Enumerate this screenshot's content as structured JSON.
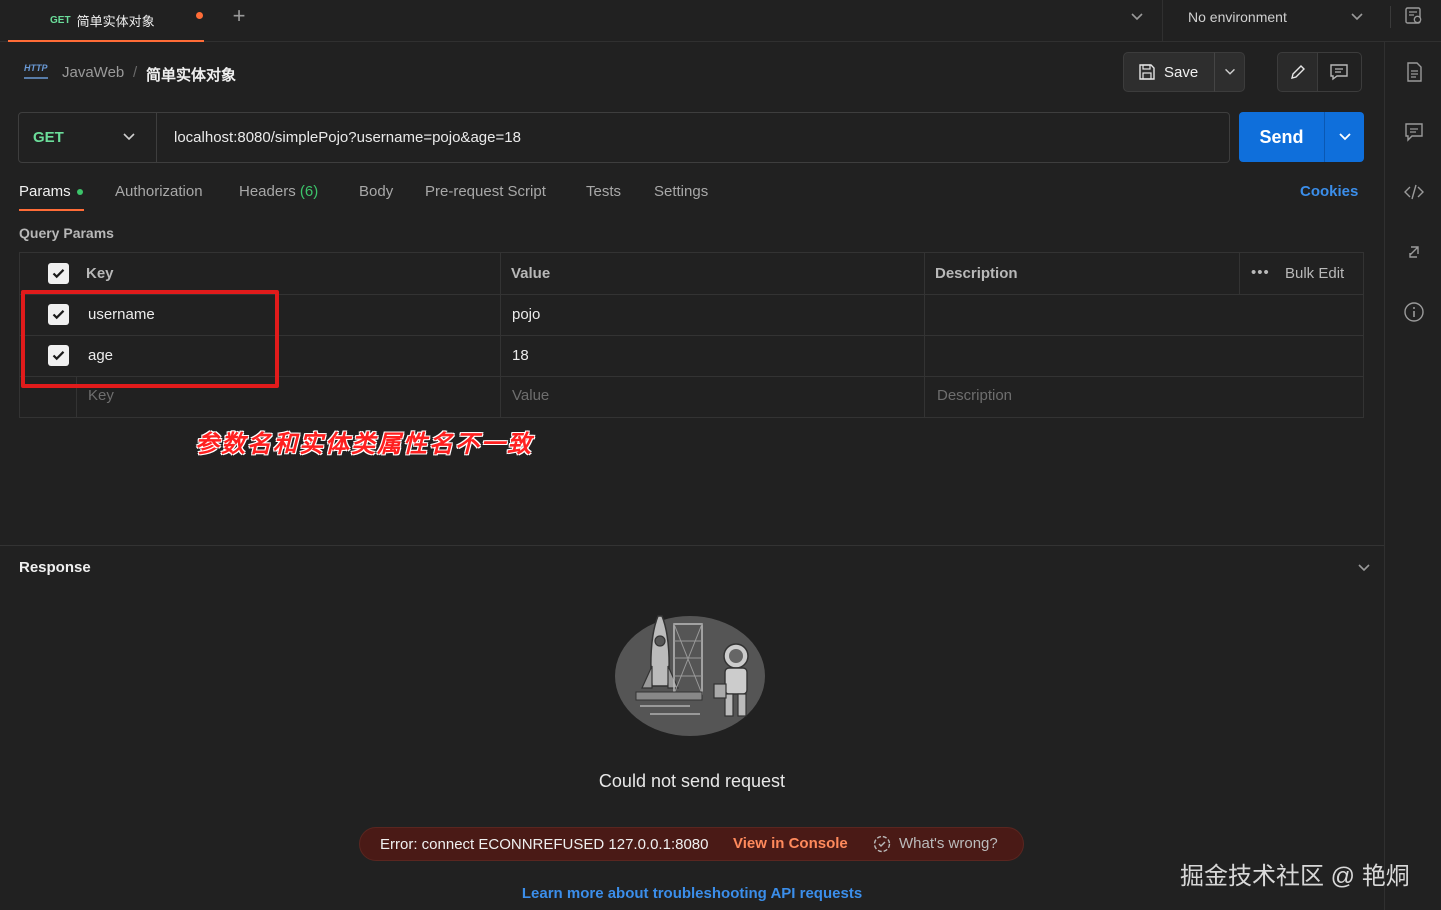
{
  "tabs": {
    "active": {
      "method": "GET",
      "name": "简单实体对象"
    }
  },
  "environment": {
    "label": "No environment"
  },
  "breadcrumb": {
    "icon_text": "HTTP",
    "parent": "JavaWeb",
    "separator": "/",
    "current": "简单实体对象"
  },
  "toolbar": {
    "save_label": "Save"
  },
  "request": {
    "method": "GET",
    "url": "localhost:8080/simplePojo?username=pojo&age=18",
    "send_label": "Send"
  },
  "request_tabs": {
    "params": "Params",
    "authorization": "Authorization",
    "headers": "Headers",
    "headers_count": "(6)",
    "body": "Body",
    "prerequest": "Pre-request Script",
    "tests": "Tests",
    "settings": "Settings",
    "cookies": "Cookies"
  },
  "query_params": {
    "title": "Query Params",
    "columns": {
      "key": "Key",
      "value": "Value",
      "description": "Description"
    },
    "bulk_dots": "•••",
    "bulk_edit": "Bulk Edit",
    "rows": [
      {
        "key": "username",
        "value": "pojo",
        "checked": true
      },
      {
        "key": "age",
        "value": "18",
        "checked": true
      }
    ],
    "placeholders": {
      "key": "Key",
      "value": "Value",
      "description": "Description"
    }
  },
  "annotation": "参数名和实体类属性名不一致",
  "response": {
    "title": "Response",
    "message": "Could not send request",
    "error": "Error: connect ECONNREFUSED 127.0.0.1:8080",
    "view_console": "View in Console",
    "whats_wrong": "What's wrong?",
    "learn_more": "Learn more about troubleshooting API requests"
  },
  "watermark": "掘金技术社区 @ 艳烔",
  "colors": {
    "accent": "#ff6c37",
    "send": "#0f6fdb",
    "method_get": "#6bdd9a",
    "link": "#3b8eea",
    "annotation": "#ff2020"
  }
}
